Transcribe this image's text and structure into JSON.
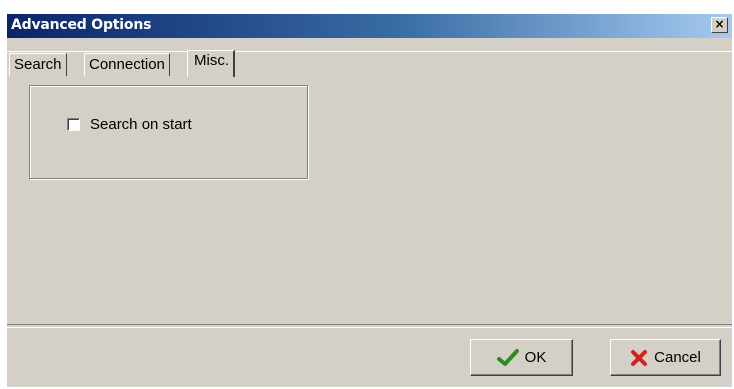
{
  "window": {
    "title": "Advanced Options",
    "close_symbol": "×"
  },
  "tabs": [
    {
      "label": "Search",
      "active": false
    },
    {
      "label": "Connection",
      "active": false
    },
    {
      "label": "Misc.",
      "active": true
    }
  ],
  "misc": {
    "search_on_start": {
      "label": "Search on start",
      "checked": false
    }
  },
  "buttons": {
    "ok": {
      "label": "OK",
      "icon": "checkmark-icon",
      "color": "#2e8b1e"
    },
    "cancel": {
      "label": "Cancel",
      "icon": "x-cross-icon",
      "color": "#d42020"
    }
  },
  "colors": {
    "face": "#d4d0c8",
    "titlebar_start": "#0a246a",
    "titlebar_end": "#a6caf0"
  }
}
